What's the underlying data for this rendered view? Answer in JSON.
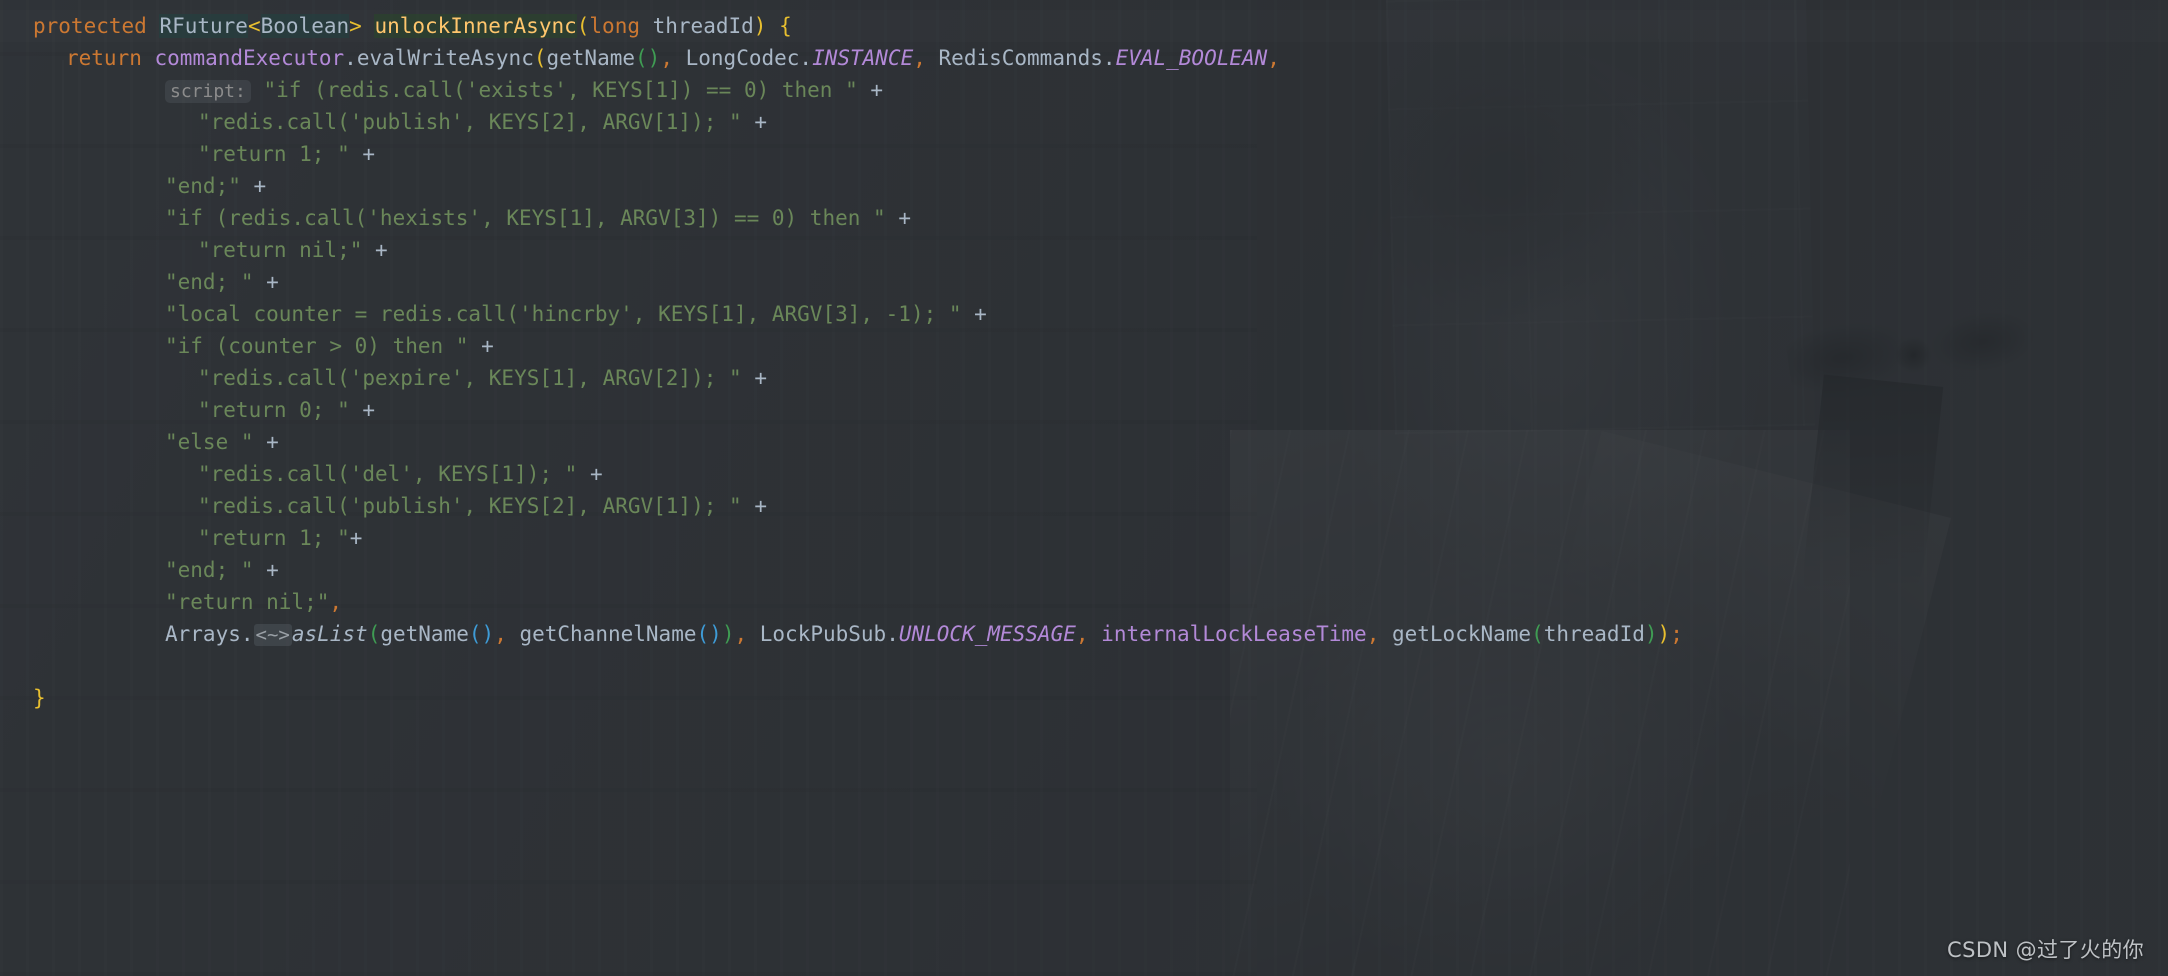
{
  "editor": {
    "theme": "darcula",
    "background_color": "#31343a",
    "default_text_color": "#a9b7c6",
    "font_size_px": 21,
    "line_height_px": 32
  },
  "colors": {
    "keyword": "#cc7832",
    "string": "#6a8759",
    "method_declaration": "#ffc66d",
    "field": "#b389d8",
    "constant": "#b389d8",
    "identifier": "#a9b7c6",
    "generic_bracket": "#e8bf2f",
    "paren_level_1": "#e8bf2f",
    "paren_level_2": "#3f9c53",
    "paren_level_3": "#3e9bd6",
    "inlay_hint": "#8c8c8c"
  },
  "code": {
    "language": "java",
    "lines": [
      {
        "indent": 1,
        "text": "protected RFuture<Boolean> unlockInnerAsync(long threadId) {",
        "tokens": [
          {
            "t": "protected",
            "c": "kw"
          },
          {
            "t": " ",
            "c": "op"
          },
          {
            "t": "RFuture",
            "c": "type",
            "hl": "usage"
          },
          {
            "t": "<",
            "c": "gen"
          },
          {
            "t": "Boolean",
            "c": "gentype",
            "hl": "usage"
          },
          {
            "t": ">",
            "c": "gen"
          },
          {
            "t": " ",
            "c": "op"
          },
          {
            "t": "unlockInnerAsync",
            "c": "mdecl",
            "hl": "decl"
          },
          {
            "t": "(",
            "c": "p1"
          },
          {
            "t": "long",
            "c": "kw"
          },
          {
            "t": " threadId",
            "c": "ident"
          },
          {
            "t": ")",
            "c": "p1"
          },
          {
            "t": " ",
            "c": "op"
          },
          {
            "t": "{",
            "c": "brace"
          }
        ]
      },
      {
        "indent": 2,
        "text": "return commandExecutor.evalWriteAsync(getName(), LongCodec.INSTANCE, RedisCommands.EVAL_BOOLEAN,",
        "tokens": [
          {
            "t": "return",
            "c": "kw"
          },
          {
            "t": " ",
            "c": "op"
          },
          {
            "t": "commandExecutor",
            "c": "field"
          },
          {
            "t": ".",
            "c": "op"
          },
          {
            "t": "evalWriteAsync",
            "c": "mcall"
          },
          {
            "t": "(",
            "c": "p1"
          },
          {
            "t": "getName",
            "c": "mcall"
          },
          {
            "t": "(",
            "c": "p2"
          },
          {
            "t": ")",
            "c": "p2"
          },
          {
            "t": ",",
            "c": "comma"
          },
          {
            "t": " LongCodec",
            "c": "ident"
          },
          {
            "t": ".",
            "c": "op"
          },
          {
            "t": "INSTANCE",
            "c": "constant"
          },
          {
            "t": ",",
            "c": "comma"
          },
          {
            "t": " RedisCommands",
            "c": "ident"
          },
          {
            "t": ".",
            "c": "op"
          },
          {
            "t": "EVAL_BOOLEAN",
            "c": "constant"
          },
          {
            "t": ",",
            "c": "comma"
          }
        ]
      },
      {
        "indent": 5,
        "inlay": "script:",
        "text": "\"if (redis.call('exists', KEYS[1]) == 0) then \" +",
        "tokens": [
          {
            "t": "\"if (redis.call('exists', KEYS[1]) == 0) then \"",
            "c": "str"
          },
          {
            "t": " ",
            "c": "op"
          },
          {
            "t": "+",
            "c": "plus"
          }
        ]
      },
      {
        "indent": 6,
        "text": "\"redis.call('publish', KEYS[2], ARGV[1]); \" +",
        "tokens": [
          {
            "t": "\"redis.call('publish', KEYS[2], ARGV[1]); \"",
            "c": "str"
          },
          {
            "t": " ",
            "c": "op"
          },
          {
            "t": "+",
            "c": "plus"
          }
        ]
      },
      {
        "indent": 6,
        "text": "\"return 1; \" +",
        "tokens": [
          {
            "t": "\"return 1; \"",
            "c": "str"
          },
          {
            "t": " ",
            "c": "op"
          },
          {
            "t": "+",
            "c": "plus"
          }
        ]
      },
      {
        "indent": 5,
        "text": "\"end;\" +",
        "tokens": [
          {
            "t": "\"end;\"",
            "c": "str"
          },
          {
            "t": " ",
            "c": "op"
          },
          {
            "t": "+",
            "c": "plus"
          }
        ]
      },
      {
        "indent": 5,
        "text": "\"if (redis.call('hexists', KEYS[1], ARGV[3]) == 0) then \" +",
        "tokens": [
          {
            "t": "\"if (redis.call('hexists', KEYS[1], ARGV[3]) == 0) then \"",
            "c": "str"
          },
          {
            "t": " ",
            "c": "op"
          },
          {
            "t": "+",
            "c": "plus"
          }
        ]
      },
      {
        "indent": 6,
        "text": "\"return nil;\" +",
        "tokens": [
          {
            "t": "\"return nil;\"",
            "c": "str"
          },
          {
            "t": " ",
            "c": "op"
          },
          {
            "t": "+",
            "c": "plus"
          }
        ]
      },
      {
        "indent": 5,
        "text": "\"end; \" +",
        "tokens": [
          {
            "t": "\"end; \"",
            "c": "str"
          },
          {
            "t": " ",
            "c": "op"
          },
          {
            "t": "+",
            "c": "plus"
          }
        ]
      },
      {
        "indent": 5,
        "text": "\"local counter = redis.call('hincrby', KEYS[1], ARGV[3], -1); \" +",
        "tokens": [
          {
            "t": "\"local counter = redis.call('hincrby', KEYS[1], ARGV[3], -1); \"",
            "c": "str"
          },
          {
            "t": " ",
            "c": "op"
          },
          {
            "t": "+",
            "c": "plus"
          }
        ]
      },
      {
        "indent": 5,
        "text": "\"if (counter > 0) then \" +",
        "tokens": [
          {
            "t": "\"if (counter > 0) then \"",
            "c": "str"
          },
          {
            "t": " ",
            "c": "op"
          },
          {
            "t": "+",
            "c": "plus"
          }
        ]
      },
      {
        "indent": 6,
        "text": "\"redis.call('pexpire', KEYS[1], ARGV[2]); \" +",
        "tokens": [
          {
            "t": "\"redis.call('pexpire', KEYS[1], ARGV[2]); \"",
            "c": "str"
          },
          {
            "t": " ",
            "c": "op"
          },
          {
            "t": "+",
            "c": "plus"
          }
        ]
      },
      {
        "indent": 6,
        "text": "\"return 0; \" +",
        "tokens": [
          {
            "t": "\"return 0; \"",
            "c": "str"
          },
          {
            "t": " ",
            "c": "op"
          },
          {
            "t": "+",
            "c": "plus"
          }
        ]
      },
      {
        "indent": 5,
        "text": "\"else \" +",
        "tokens": [
          {
            "t": "\"else \"",
            "c": "str"
          },
          {
            "t": " ",
            "c": "op"
          },
          {
            "t": "+",
            "c": "plus"
          }
        ]
      },
      {
        "indent": 6,
        "text": "\"redis.call('del', KEYS[1]); \" +",
        "tokens": [
          {
            "t": "\"redis.call('del', KEYS[1]); \"",
            "c": "str"
          },
          {
            "t": " ",
            "c": "op"
          },
          {
            "t": "+",
            "c": "plus"
          }
        ]
      },
      {
        "indent": 6,
        "text": "\"redis.call('publish', KEYS[2], ARGV[1]); \" +",
        "tokens": [
          {
            "t": "\"redis.call('publish', KEYS[2], ARGV[1]); \"",
            "c": "str"
          },
          {
            "t": " ",
            "c": "op"
          },
          {
            "t": "+",
            "c": "plus"
          }
        ]
      },
      {
        "indent": 6,
        "text": "\"return 1; \"+",
        "tokens": [
          {
            "t": "\"return 1; \"",
            "c": "str"
          },
          {
            "t": "+",
            "c": "plus"
          }
        ]
      },
      {
        "indent": 5,
        "text": "\"end; \" +",
        "tokens": [
          {
            "t": "\"end; \"",
            "c": "str"
          },
          {
            "t": " ",
            "c": "op"
          },
          {
            "t": "+",
            "c": "plus"
          }
        ]
      },
      {
        "indent": 5,
        "text": "\"return nil;\",",
        "tokens": [
          {
            "t": "\"return nil;\"",
            "c": "str"
          },
          {
            "t": ",",
            "c": "comma"
          }
        ]
      },
      {
        "indent": 5,
        "text": "Arrays.<~>asList(getName(), getChannelName()), LockPubSub.UNLOCK_MESSAGE, internalLockLeaseTime, getLockName(threadId));",
        "tokens": [
          {
            "t": "Arrays",
            "c": "ident"
          },
          {
            "t": ".",
            "c": "op"
          },
          {
            "t": "<~>",
            "c": "inlay-chev"
          },
          {
            "t": "asList",
            "c": "statm"
          },
          {
            "t": "(",
            "c": "p2"
          },
          {
            "t": "getName",
            "c": "mcall"
          },
          {
            "t": "(",
            "c": "p3"
          },
          {
            "t": ")",
            "c": "p3"
          },
          {
            "t": ",",
            "c": "comma"
          },
          {
            "t": " getChannelName",
            "c": "mcall"
          },
          {
            "t": "(",
            "c": "p3"
          },
          {
            "t": ")",
            "c": "p3"
          },
          {
            "t": ")",
            "c": "p2"
          },
          {
            "t": ",",
            "c": "comma"
          },
          {
            "t": " LockPubSub",
            "c": "ident"
          },
          {
            "t": ".",
            "c": "op"
          },
          {
            "t": "UNLOCK_MESSAGE",
            "c": "constant"
          },
          {
            "t": ",",
            "c": "comma"
          },
          {
            "t": " internalLockLeaseTime",
            "c": "field"
          },
          {
            "t": ",",
            "c": "comma"
          },
          {
            "t": " getLockName",
            "c": "mcall"
          },
          {
            "t": "(",
            "c": "p2"
          },
          {
            "t": "threadId",
            "c": "ident"
          },
          {
            "t": ")",
            "c": "p2"
          },
          {
            "t": ")",
            "c": "p1"
          },
          {
            "t": ";",
            "c": "semi"
          }
        ]
      },
      {
        "indent": 0,
        "text": "",
        "tokens": []
      },
      {
        "indent": 1,
        "text": "}",
        "tokens": [
          {
            "t": "}",
            "c": "brace"
          }
        ]
      }
    ]
  },
  "watermark": {
    "text": "CSDN @过了火的你"
  }
}
